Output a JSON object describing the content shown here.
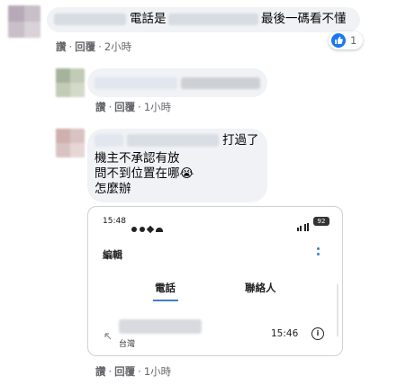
{
  "comment1": {
    "text_prefix": "電話是",
    "text_suffix": "最後一碼看不懂",
    "actions": {
      "like": "讚",
      "reply": "回覆",
      "time": "2小時"
    },
    "reaction_count": "1"
  },
  "reply1": {
    "actions": {
      "like": "讚",
      "reply": "回覆",
      "time": "1小時"
    }
  },
  "reply2": {
    "name_suffix": "打過了",
    "lines": [
      "機主不承認有放",
      "問不到位置在哪😭",
      "怎麼辦"
    ],
    "actions": {
      "like": "讚",
      "reply": "回覆",
      "time": "1小時"
    },
    "screenshot": {
      "status_time": "15:48",
      "battery": "92",
      "header_title": "編輯",
      "tab_active": "電話",
      "tab_inactive": "聯絡人",
      "call_location": "台灣",
      "call_time": "15:46",
      "info_glyph": "i"
    }
  },
  "colors": {
    "bubble_bg": "#f0f2f5",
    "meta_text": "#65676b",
    "like_blue": "#1877f2",
    "tab_underline": "#3e7fcf"
  }
}
